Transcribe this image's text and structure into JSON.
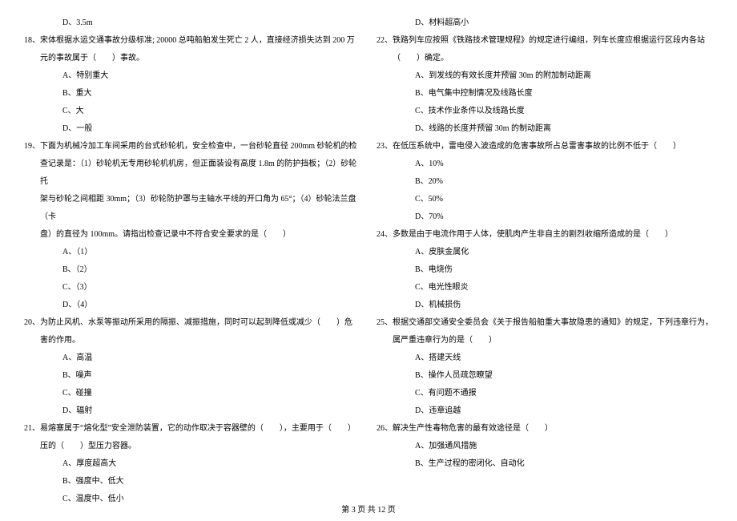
{
  "left": {
    "opt17d": "D、3.5m",
    "q18": "18、宋体根据水运交通事故分级标准; 20000 总吨船舶发生死亡 2 人，直接经济损失达到 200 万",
    "q18b": "元的事故属于（　　）事故。",
    "q18_a": "A、特别重大",
    "q18_b": "B、重大",
    "q18_c": "C、大",
    "q18_d": "D、一般",
    "q19": "19、下面为机械冷加工车间采用的台式砂轮机，安全检查中，一台砂轮直径 200mm 砂轮机的检",
    "q19b": "查记录是：（1）砂轮机无专用砂轮机机房，但正面装设有高度 1.8m 的防护挡板；（2）砂轮托",
    "q19c": "架与砂轮之间相距 30mm；（3）砂轮防护罩与主轴水平线的开口角为 65°；（4）砂轮法兰盘（卡",
    "q19d": "盘）的直径为 100mm。请指出检查记录中不符合安全要求的是（　　）",
    "q19_a": "A、（1）",
    "q19_b": "B、（2）",
    "q19_c": "C、（3）",
    "q19_d": "D、（4）",
    "q20": "20、为防止风机、水泵等振动所采用的隔振、减振措施，同时可以起到降低或减少（　　）危",
    "q20b": "害的作用。",
    "q20_a": "A、高温",
    "q20_b": "B、噪声",
    "q20_c": "C、碰撞",
    "q20_d": "D、辐射",
    "q21": "21、易熔塞属于“熔化型”安全泄防装置，它的动作取决于容器壁的（　　），主要用于（　　）",
    "q21b": "压的（　　）型压力容器。",
    "q21_a": "A、厚度超高大",
    "q21_b": "B、强度中、低大",
    "q21_c": "C、温度中、低小"
  },
  "right": {
    "q21_d": "D、材料超高小",
    "q22": "22、铁路列车应按照《铁路技术管理规程》的规定进行编组，列车长度应根据运行区段内各站",
    "q22b": "（　　）确定。",
    "q22_a": "A、到发线的有效长度并预留 30m 的附加制动距离",
    "q22_b": "B、电气集中控制情况及线路长度",
    "q22_c": "C、技术作业条件以及线路长度",
    "q22_d": "D、线路的长度并预留 30m 的制动距离",
    "q23": "23、在低压系统中，雷电侵入波造成的危害事故所占总雷害事故的比例不低于（　　）",
    "q23_a": "A、10%",
    "q23_b": "B、20%",
    "q23_c": "C、50%",
    "q23_d": "D、70%",
    "q24": "24、多数是由于电流作用于人体，使肌肉产生非自主的剧烈收缩所造成的是（　　）",
    "q24_a": "A、皮肤金属化",
    "q24_b": "B、电烧伤",
    "q24_c": "C、电光性眼炎",
    "q24_d": "D、机械损伤",
    "q25": "25、根据交通部交通安全委员会《关于报告船舶重大事故隐患的通知》的规定，下列违章行为，",
    "q25b": "属严重违章行为的是（　　）",
    "q25_a": "A、搭建天线",
    "q25_b": "B、操作人员疏忽瞭望",
    "q25_c": "C、有问题不通报",
    "q25_d": "D、违章追越",
    "q26": "26、解决生产性毒物危害的最有效途径是（　　）",
    "q26_a": "A、加强通风措施",
    "q26_b": "B、生产过程的密闭化、自动化"
  },
  "footer": "第 3 页 共 12 页"
}
